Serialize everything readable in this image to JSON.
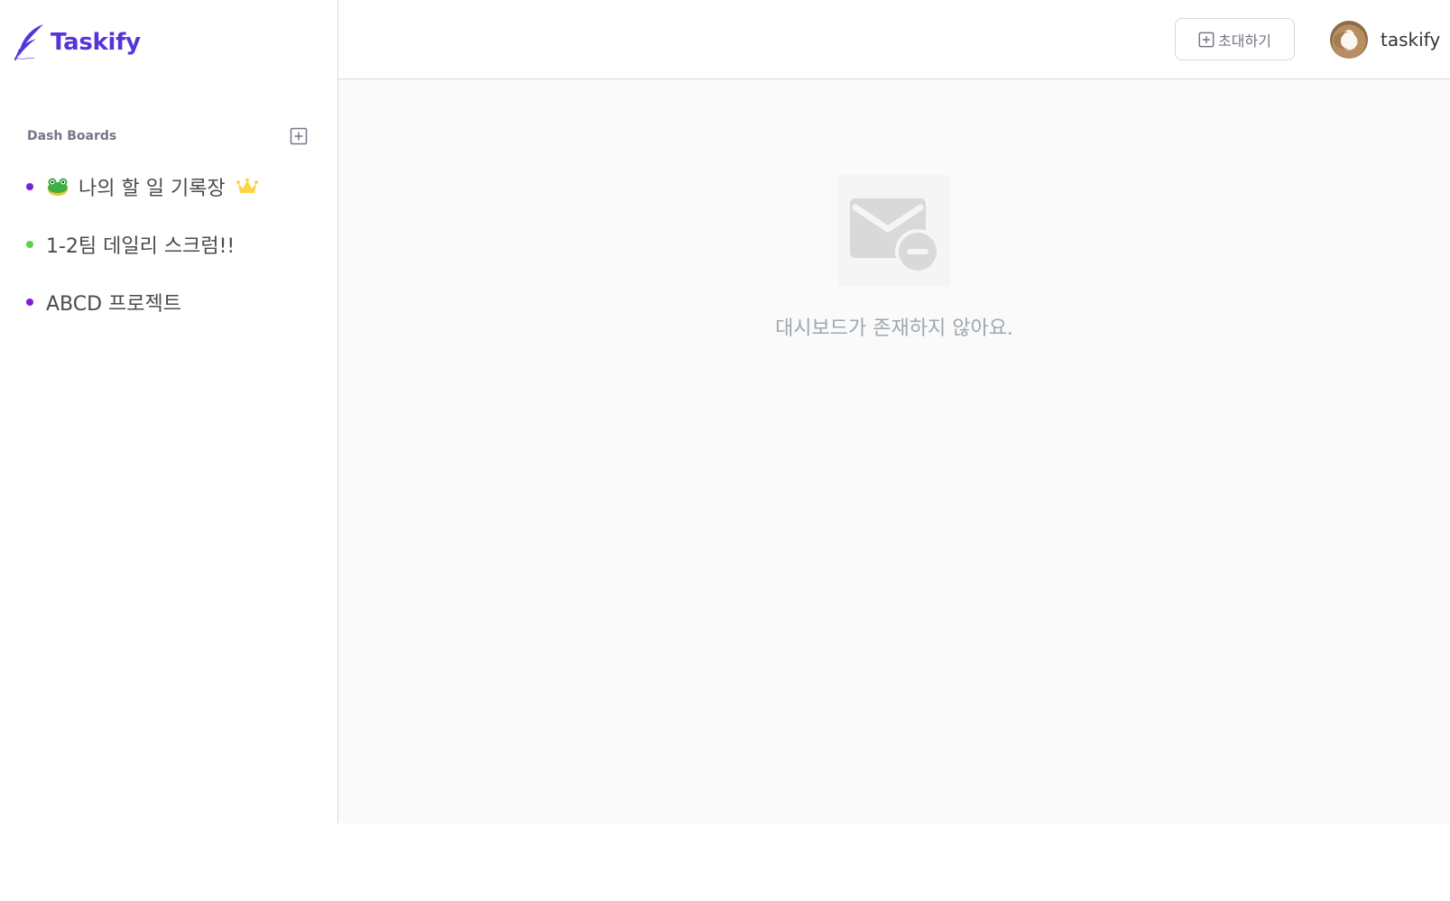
{
  "brand": {
    "name": "Taskify",
    "color": "#5534da"
  },
  "sidebar": {
    "section_title": "Dash Boards",
    "add_icon": "plus-square-icon",
    "boards": [
      {
        "name": "나의 할 일 기록장",
        "dot_color": "#7c1ee0",
        "leading_emoji": "frog-icon",
        "owner": true
      },
      {
        "name": "1-2팀 데일리 스크럼!!",
        "dot_color": "#5fcf4f",
        "leading_emoji": "",
        "owner": false
      },
      {
        "name": "ABCD 프로젝트",
        "dot_color": "#7c1ee0",
        "leading_emoji": "",
        "owner": false
      }
    ]
  },
  "header": {
    "invite_label": "초대하기",
    "invite_icon": "plus-square-icon",
    "user_name": "taskify"
  },
  "main": {
    "empty_icon": "mail-minus-icon",
    "empty_message": "대시보드가 존재하지 않아요."
  }
}
